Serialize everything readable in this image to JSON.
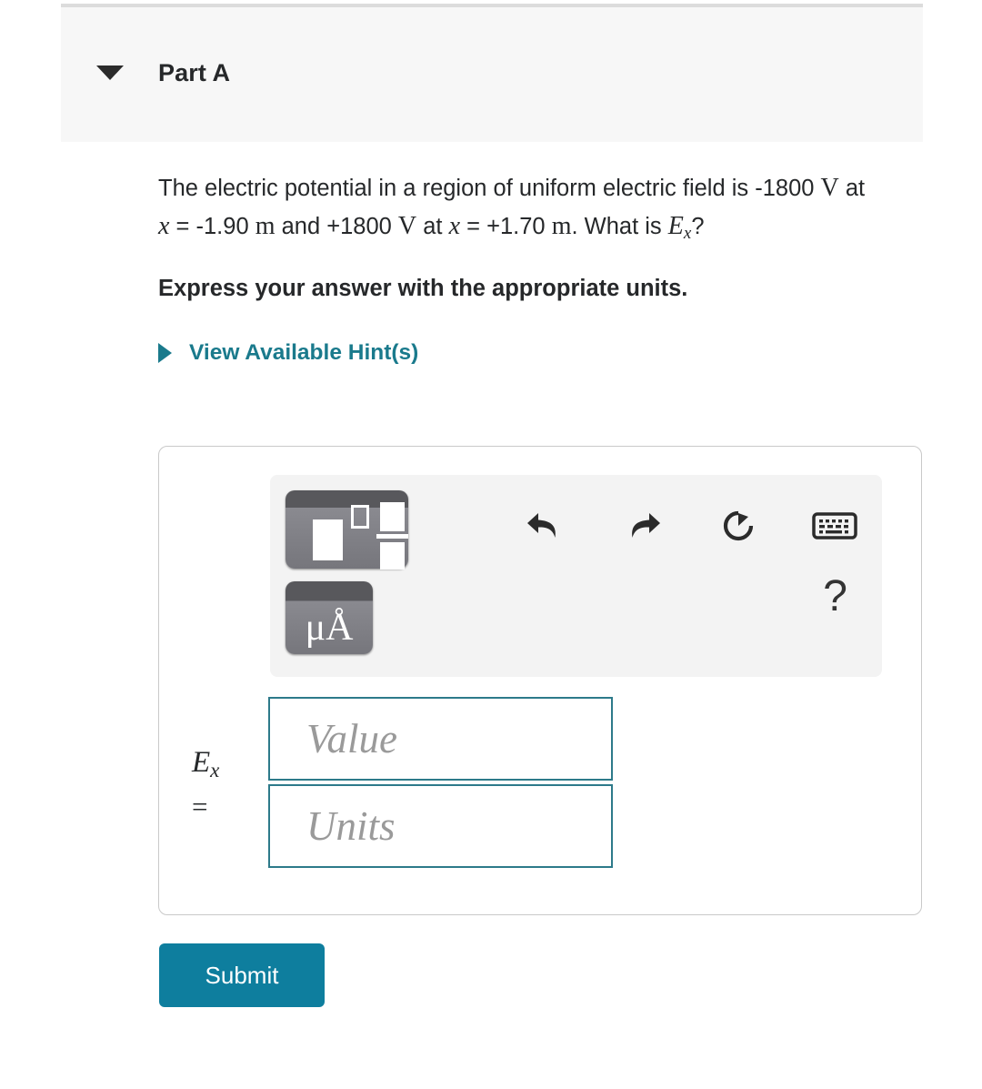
{
  "part": {
    "title": "Part A",
    "collapse_icon": "caret-down-icon",
    "expanded": true
  },
  "question": {
    "line1_a": "The electric potential in a region of uniform electric field is -1800 ",
    "unit_volt_1": "V",
    "line1_b": " at ",
    "var_x_1": "x",
    "line1_c": " = -1.90 ",
    "unit_meter_1": "m",
    "line1_d": " and +1800 ",
    "unit_volt_2": "V",
    "line1_e": " at ",
    "var_x_2": "x",
    "line1_f": " = +1.70 ",
    "unit_meter_2": "m",
    "line1_g": ". What is ",
    "field_symbol": "E",
    "field_subscript": "x",
    "line1_h": "?"
  },
  "instruction": "Express your answer with the appropriate units.",
  "hints": {
    "label": "View Available Hint(s)",
    "expand_icon": "caret-right-icon",
    "color": "#1a7a8c"
  },
  "answer_toolbar": {
    "template_button_name": "math-template-button",
    "units_button_label": "μÅ",
    "icons": [
      {
        "name": "undo-icon",
        "label": "Undo"
      },
      {
        "name": "redo-icon",
        "label": "Redo"
      },
      {
        "name": "reset-icon",
        "label": "Reset"
      },
      {
        "name": "keyboard-icon",
        "label": "Keyboard shortcuts"
      }
    ],
    "help_label": "?"
  },
  "answer_input": {
    "variable_symbol": "E",
    "variable_subscript": "x",
    "equals": "=",
    "value_placeholder": "Value",
    "units_placeholder": "Units",
    "value_text": "",
    "units_text": "",
    "border_color": "#2d7a8a"
  },
  "submit": {
    "label": "Submit",
    "color": "#0e7e9e"
  }
}
